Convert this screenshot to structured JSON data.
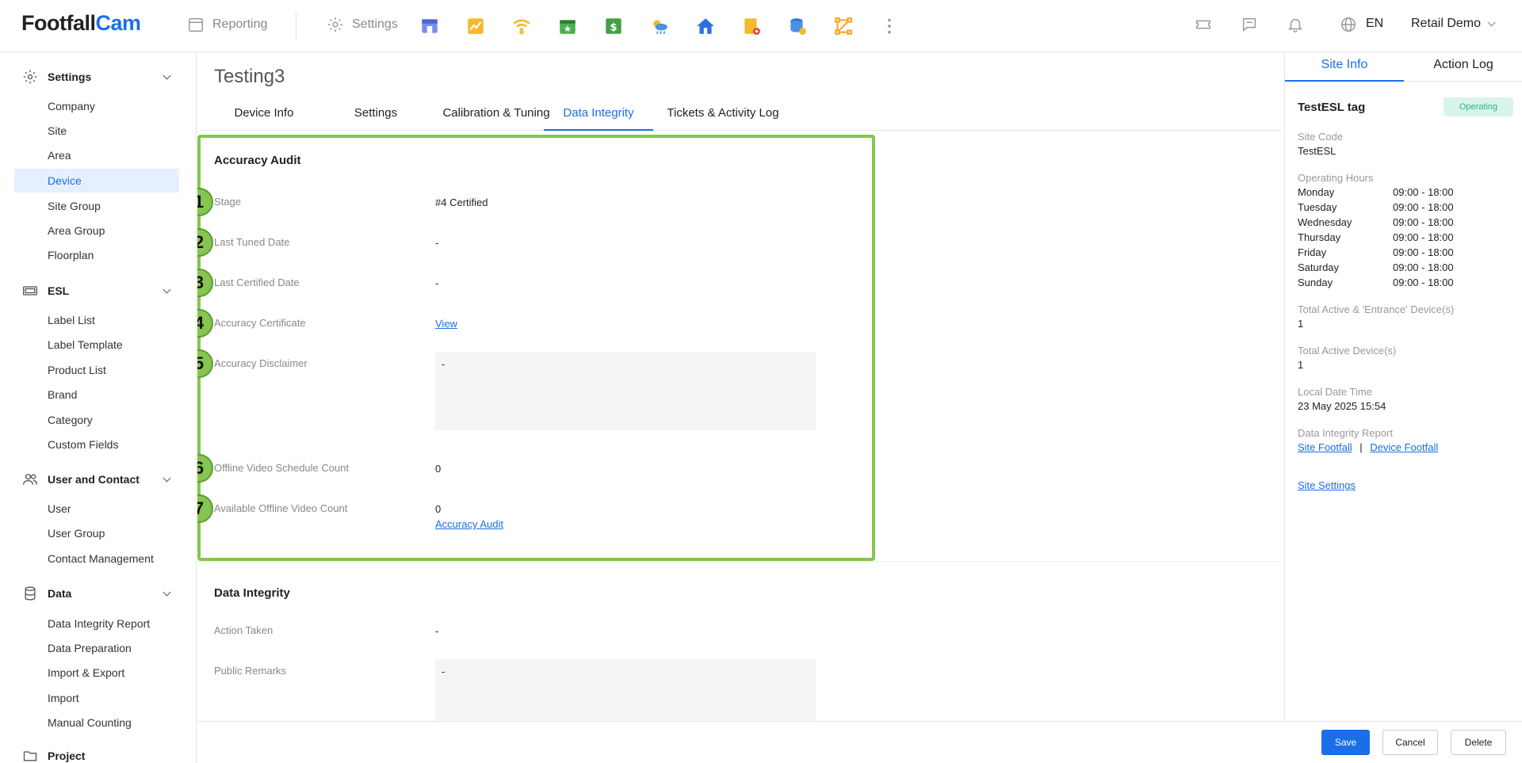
{
  "brand": {
    "part1": "Footfall",
    "part2": "Cam"
  },
  "top_nav": {
    "reporting": "Reporting",
    "settings": "Settings"
  },
  "top_right": {
    "lang": "EN",
    "account": "Retail Demo"
  },
  "sidebar": {
    "groups": [
      {
        "label": "Settings",
        "items": [
          "Company",
          "Site",
          "Area",
          "Device",
          "Site Group",
          "Area Group",
          "Floorplan"
        ]
      },
      {
        "label": "ESL",
        "items": [
          "Label List",
          "Label Template",
          "Product List",
          "Brand",
          "Category",
          "Custom Fields"
        ]
      },
      {
        "label": "User and Contact",
        "items": [
          "User",
          "User Group",
          "Contact Management"
        ]
      },
      {
        "label": "Data",
        "items": [
          "Data Integrity Report",
          "Data Preparation",
          "Import & Export",
          "Import",
          "Manual Counting"
        ]
      },
      {
        "label": "Project",
        "items": []
      }
    ],
    "active_item": "Device"
  },
  "page": {
    "title": "Testing3",
    "tabs": [
      "Device Info",
      "Settings",
      "Calibration & Tuning",
      "Data Integrity",
      "Tickets & Activity Log"
    ],
    "active_tab": "Data Integrity"
  },
  "accuracy_audit": {
    "title": "Accuracy Audit",
    "fields": [
      {
        "step": "1",
        "label": "Stage",
        "value": "#4 Certified"
      },
      {
        "step": "2",
        "label": "Last Tuned Date",
        "value": "-"
      },
      {
        "step": "3",
        "label": "Last Certified Date",
        "value": "-"
      },
      {
        "step": "4",
        "label": "Accuracy Certificate",
        "value": "View"
      },
      {
        "step": "5",
        "label": "Accuracy Disclaimer",
        "value": "-"
      },
      {
        "step": "6",
        "label": "Offline Video Schedule Count",
        "value": "0"
      },
      {
        "step": "7",
        "label": "Available Offline Video Count",
        "value": "0"
      }
    ],
    "audit_link": "Accuracy Audit"
  },
  "data_integrity": {
    "title": "Data Integrity",
    "action_taken_label": "Action Taken",
    "action_taken_value": "-",
    "public_remarks_label": "Public Remarks",
    "public_remarks_value": "-"
  },
  "right_panel": {
    "tabs": [
      "Site Info",
      "Action Log"
    ],
    "active_tab": "Site Info",
    "site_name": "TestESL tag",
    "status": "Operating",
    "site_code_label": "Site Code",
    "site_code": "TestESL",
    "hours_label": "Operating Hours",
    "hours": [
      {
        "day": "Monday",
        "time": "09:00 - 18:00"
      },
      {
        "day": "Tuesday",
        "time": "09:00 - 18:00"
      },
      {
        "day": "Wednesday",
        "time": "09:00 - 18:00"
      },
      {
        "day": "Thursday",
        "time": "09:00 - 18:00"
      },
      {
        "day": "Friday",
        "time": "09:00 - 18:00"
      },
      {
        "day": "Saturday",
        "time": "09:00 - 18:00"
      },
      {
        "day": "Sunday",
        "time": "09:00 - 18:00"
      }
    ],
    "entrance_devices_label": "Total Active & 'Entrance' Device(s)",
    "entrance_devices": "1",
    "active_devices_label": "Total Active Device(s)",
    "active_devices": "1",
    "local_time_label": "Local Date Time",
    "local_time": "23 May 2025 15:54",
    "report_label": "Data Integrity Report",
    "site_footfall": "Site Footfall",
    "report_sep": "|",
    "device_footfall": "Device Footfall",
    "site_settings": "Site Settings"
  },
  "footer": {
    "save": "Save",
    "cancel": "Cancel",
    "delete": "Delete"
  },
  "colors": {
    "accent": "#1a6ee8",
    "highlight": "#86c54f",
    "operating": "#2bb386"
  }
}
